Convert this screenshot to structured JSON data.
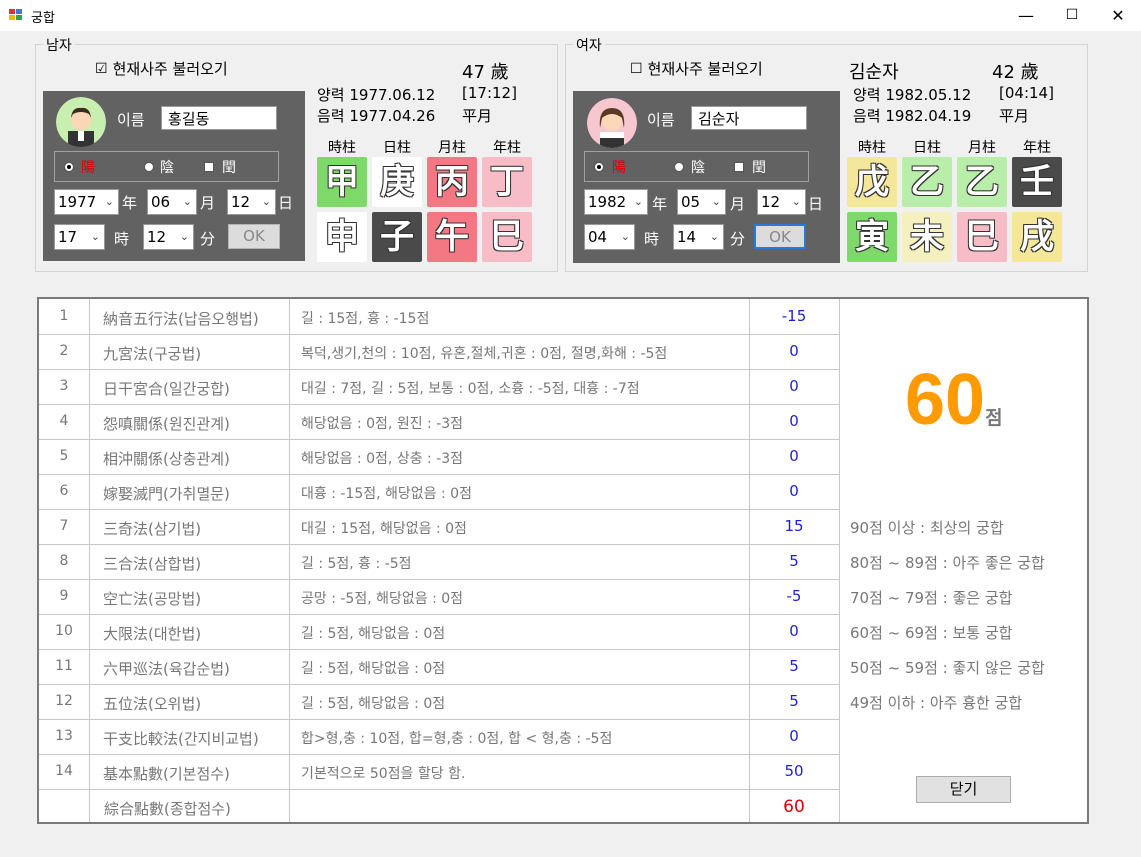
{
  "window": {
    "title": "궁합",
    "minimize": "—",
    "maximize": "☐",
    "close": "✕"
  },
  "male": {
    "group_label": "남자",
    "load_checkbox": {
      "label": "현재사주 불러오기",
      "checked": true
    },
    "age": "47 歲",
    "solar": "양력 1977.06.12",
    "time": "[17:12]",
    "lunar": "음력 1977.04.26",
    "month_type": "平月",
    "name_label": "이름",
    "name": "홍길동",
    "calendar": {
      "yang": "陽",
      "eum": "陰",
      "yun": "閏"
    },
    "year": "1977",
    "year_unit": "年",
    "month": "06",
    "month_unit": "月",
    "day": "12",
    "day_unit": "日",
    "hour": "17",
    "hour_unit": "時",
    "minute": "12",
    "minute_unit": "分",
    "ok": "OK",
    "pillar_heads": [
      "時柱",
      "日柱",
      "月柱",
      "年柱"
    ],
    "stems": [
      "甲",
      "庚",
      "丙",
      "丁"
    ],
    "branches": [
      "申",
      "子",
      "午",
      "巳"
    ],
    "stem_colors": [
      "#7fd96a",
      "#ffffff",
      "#f47884",
      "#f7bcc6"
    ],
    "branch_colors": [
      "#ffffff",
      "#4a4a4a",
      "#f47884",
      "#f7bcc6"
    ]
  },
  "female": {
    "group_label": "여자",
    "load_checkbox": {
      "label": "현재사주 불러오기",
      "checked": false
    },
    "name_display": "김순자",
    "age": "42 歲",
    "solar": "양력 1982.05.12",
    "time": "[04:14]",
    "lunar": "음력 1982.04.19",
    "month_type": "平月",
    "name_label": "이름",
    "name": "김순자",
    "calendar": {
      "yang": "陽",
      "eum": "陰",
      "yun": "閏"
    },
    "year": "1982",
    "year_unit": "年",
    "month": "05",
    "month_unit": "月",
    "day": "12",
    "day_unit": "日",
    "hour": "04",
    "hour_unit": "時",
    "minute": "14",
    "minute_unit": "分",
    "ok": "OK",
    "pillar_heads": [
      "時柱",
      "日柱",
      "月柱",
      "年柱"
    ],
    "stems": [
      "戊",
      "乙",
      "乙",
      "壬"
    ],
    "branches": [
      "寅",
      "未",
      "巳",
      "戌"
    ],
    "stem_colors": [
      "#f5e79a",
      "#b9edaa",
      "#b9edaa",
      "#4a4a4a"
    ],
    "branch_colors": [
      "#7fd96a",
      "#f5f0bf",
      "#f7bcc6",
      "#f5e79a"
    ]
  },
  "results": [
    {
      "no": "1",
      "method": "納音五行法(납음오행법)",
      "rule": "길 : 15점, 흉 : -15점",
      "score": "-15"
    },
    {
      "no": "2",
      "method": "九宮法(구궁법)",
      "rule": "복덕,생기,천의 : 10점, 유혼,절체,귀혼 : 0점, 절명,화해 : -5점",
      "score": "0"
    },
    {
      "no": "3",
      "method": "日干宮合(일간궁합)",
      "rule": "대길 : 7점, 길 : 5점, 보통 : 0점, 소흉 : -5점, 대흉 : -7점",
      "score": "0"
    },
    {
      "no": "4",
      "method": "怨嗔關係(원진관계)",
      "rule": "해당없음 : 0점, 원진 : -3점",
      "score": "0"
    },
    {
      "no": "5",
      "method": "相沖關係(상충관계)",
      "rule": "해당없음 : 0점, 상충 : -3점",
      "score": "0"
    },
    {
      "no": "6",
      "method": "嫁娶滅門(가취멸문)",
      "rule": "대흉 : -15점, 해당없음 : 0점",
      "score": "0"
    },
    {
      "no": "7",
      "method": "三奇法(삼기법)",
      "rule": "대길 : 15점, 해당없음 : 0점",
      "score": "15"
    },
    {
      "no": "8",
      "method": "三合法(삼합법)",
      "rule": "길 : 5점, 흉 : -5점",
      "score": "5"
    },
    {
      "no": "9",
      "method": "空亡法(공망법)",
      "rule": "공망 : -5점, 해당없음 : 0점",
      "score": "-5"
    },
    {
      "no": "10",
      "method": "大限法(대한법)",
      "rule": "길 : 5점, 해당없음 : 0점",
      "score": "0"
    },
    {
      "no": "11",
      "method": "六甲巡法(육갑순법)",
      "rule": "길 : 5점, 해당없음 : 0점",
      "score": "5"
    },
    {
      "no": "12",
      "method": "五位法(오위법)",
      "rule": "길 : 5점, 해당없음 : 0점",
      "score": "5"
    },
    {
      "no": "13",
      "method": "干支比較法(간지비교법)",
      "rule": "합>형,충 : 10점, 합=형,충 : 0점, 합 < 형,충 : -5점",
      "score": "0"
    },
    {
      "no": "14",
      "method": "基本點數(기본점수)",
      "rule": "기본적으로 50점을 할당 함.",
      "score": "50"
    }
  ],
  "total": {
    "label": "綜合點數(종합점수)",
    "score": "60"
  },
  "big_score": {
    "value": "60",
    "unit": "점"
  },
  "grades": [
    "90점 이상 : 최상의 궁합",
    "80점 ~ 89점 : 아주 좋은 궁합",
    "70점 ~ 79점 : 좋은 궁합",
    "60점 ~ 69점 : 보통 궁합",
    "50점 ~ 59점 : 좋지 않은 궁합",
    "49점 이하 :  아주 흉한 궁합"
  ],
  "close_button": "닫기",
  "colors": {
    "score_blue": "#1f1fd0",
    "total_red": "#e00000",
    "big_orange": "#ff9a00",
    "yang_red": "#e00000"
  }
}
